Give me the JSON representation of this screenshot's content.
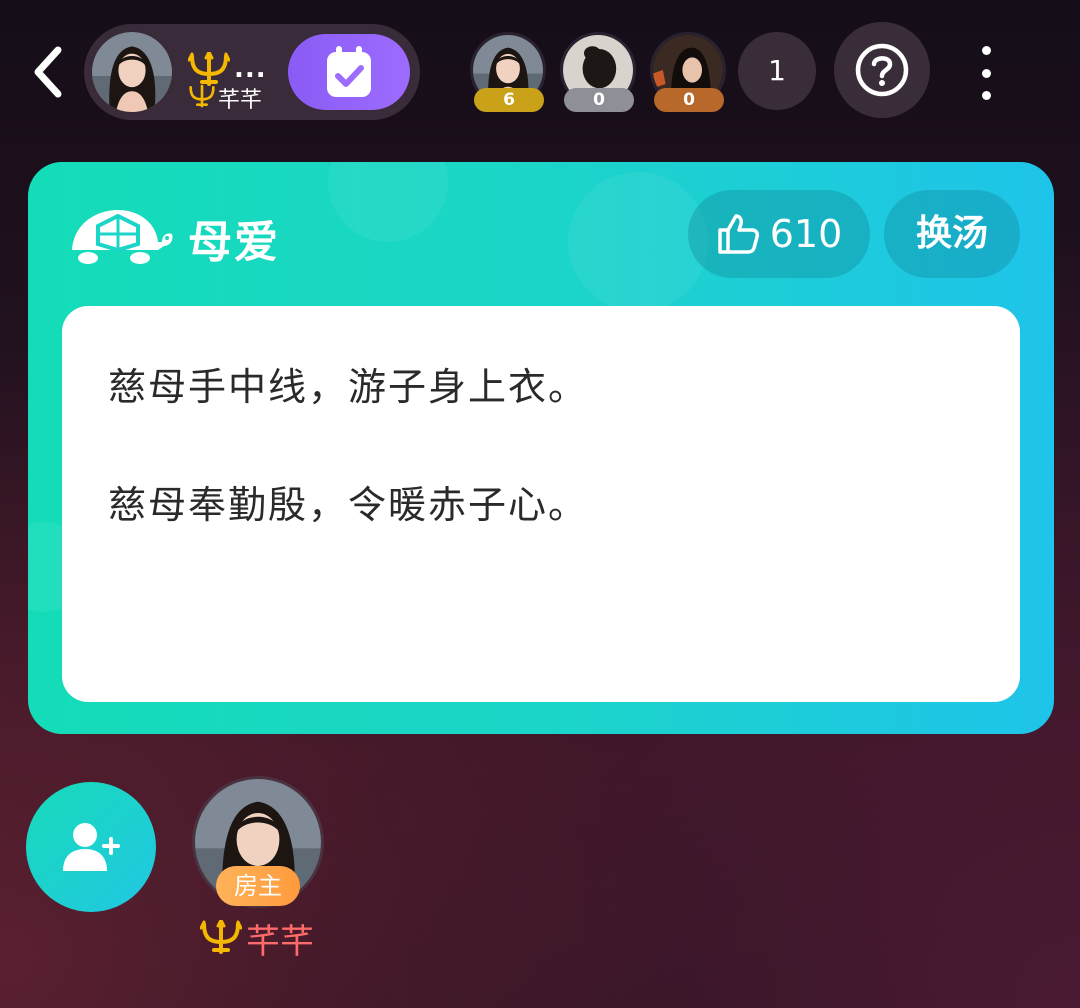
{
  "header": {
    "owner": {
      "title": "...",
      "name": "芊芊"
    },
    "viewers": [
      {
        "count": "6",
        "badge_color": "#c9a21a"
      },
      {
        "count": "0",
        "badge_color": "#8f8f98"
      },
      {
        "count": "0",
        "badge_color": "#b8682a"
      }
    ],
    "online_count": "1"
  },
  "card": {
    "topic": "母爱",
    "likes": "610",
    "swap_label": "换汤",
    "lines": [
      "慈母手中线，游子身上衣。",
      "慈母奉勤殷，令暖赤子心。"
    ]
  },
  "seats": {
    "host_badge": "房主",
    "host_name": "芊芊"
  },
  "colors": {
    "card_start": "#14dcb8",
    "card_end": "#1fc4ea",
    "checkin_button": "#8a5bf5",
    "host_badge": "#ff9a3c",
    "host_name": "#ff6a6a"
  }
}
